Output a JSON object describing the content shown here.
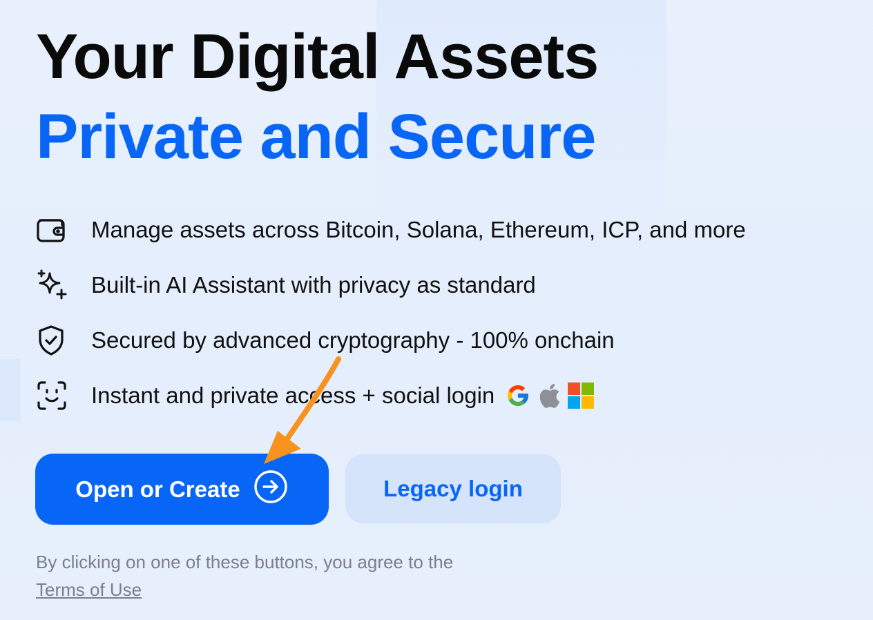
{
  "hero": {
    "title_line1": "Your Digital Assets",
    "title_line2": "Private and Secure"
  },
  "features": [
    {
      "icon": "wallet-icon",
      "text": "Manage assets across Bitcoin, Solana, Ethereum, ICP, and more"
    },
    {
      "icon": "sparkles-icon",
      "text": "Built-in AI Assistant with privacy as standard"
    },
    {
      "icon": "shield-check-icon",
      "text": "Secured by advanced cryptography - 100% onchain"
    },
    {
      "icon": "face-id-icon",
      "text": "Instant and private access + social login"
    }
  ],
  "social_logins": [
    "google-icon",
    "apple-icon",
    "microsoft-icon"
  ],
  "actions": {
    "primary_label": "Open or Create",
    "secondary_label": "Legacy login"
  },
  "terms": {
    "prefix": "By clicking on one of these buttons, you agree to the",
    "link": "Terms of Use"
  },
  "colors": {
    "accent": "#0866f7",
    "secondary_bg": "#d5e3fb",
    "annotation_arrow": "#f7931e"
  }
}
